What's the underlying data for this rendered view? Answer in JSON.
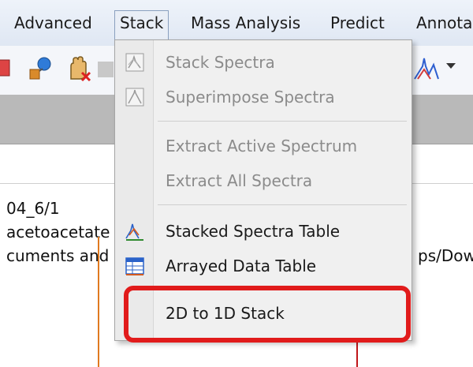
{
  "menubar": {
    "items": [
      {
        "label": "Advanced"
      },
      {
        "label": "Stack"
      },
      {
        "label": "Mass Analysis"
      },
      {
        "label": "Predict"
      },
      {
        "label": "Annota"
      }
    ]
  },
  "toolbar": {
    "icons": [
      "tool-icon",
      "network-icon",
      "hand-icon",
      "spectrum-icon"
    ]
  },
  "document": {
    "line1": "04_6/1",
    "line2": "acetoacetate",
    "line3": "cuments and",
    "line3_right": "ps/Dow"
  },
  "stack_menu": {
    "items": [
      {
        "label": "Stack Spectra",
        "icon": "stack-spectra-icon"
      },
      {
        "label": "Superimpose Spectra",
        "icon": "superimpose-spectra-icon"
      },
      {
        "label": "Extract Active Spectrum"
      },
      {
        "label": "Extract All Spectra"
      },
      {
        "label": "Stacked Spectra Table",
        "icon": "stacked-spectra-table-icon"
      },
      {
        "label": "Arrayed Data Table",
        "icon": "arrayed-data-table-icon"
      },
      {
        "label": "2D to 1D Stack"
      }
    ]
  },
  "colors": {
    "highlight": "#e11b1b",
    "menubar_bg": "#dfe7f3",
    "band": "#b9b9b9",
    "orange_line": "#e07a20"
  }
}
